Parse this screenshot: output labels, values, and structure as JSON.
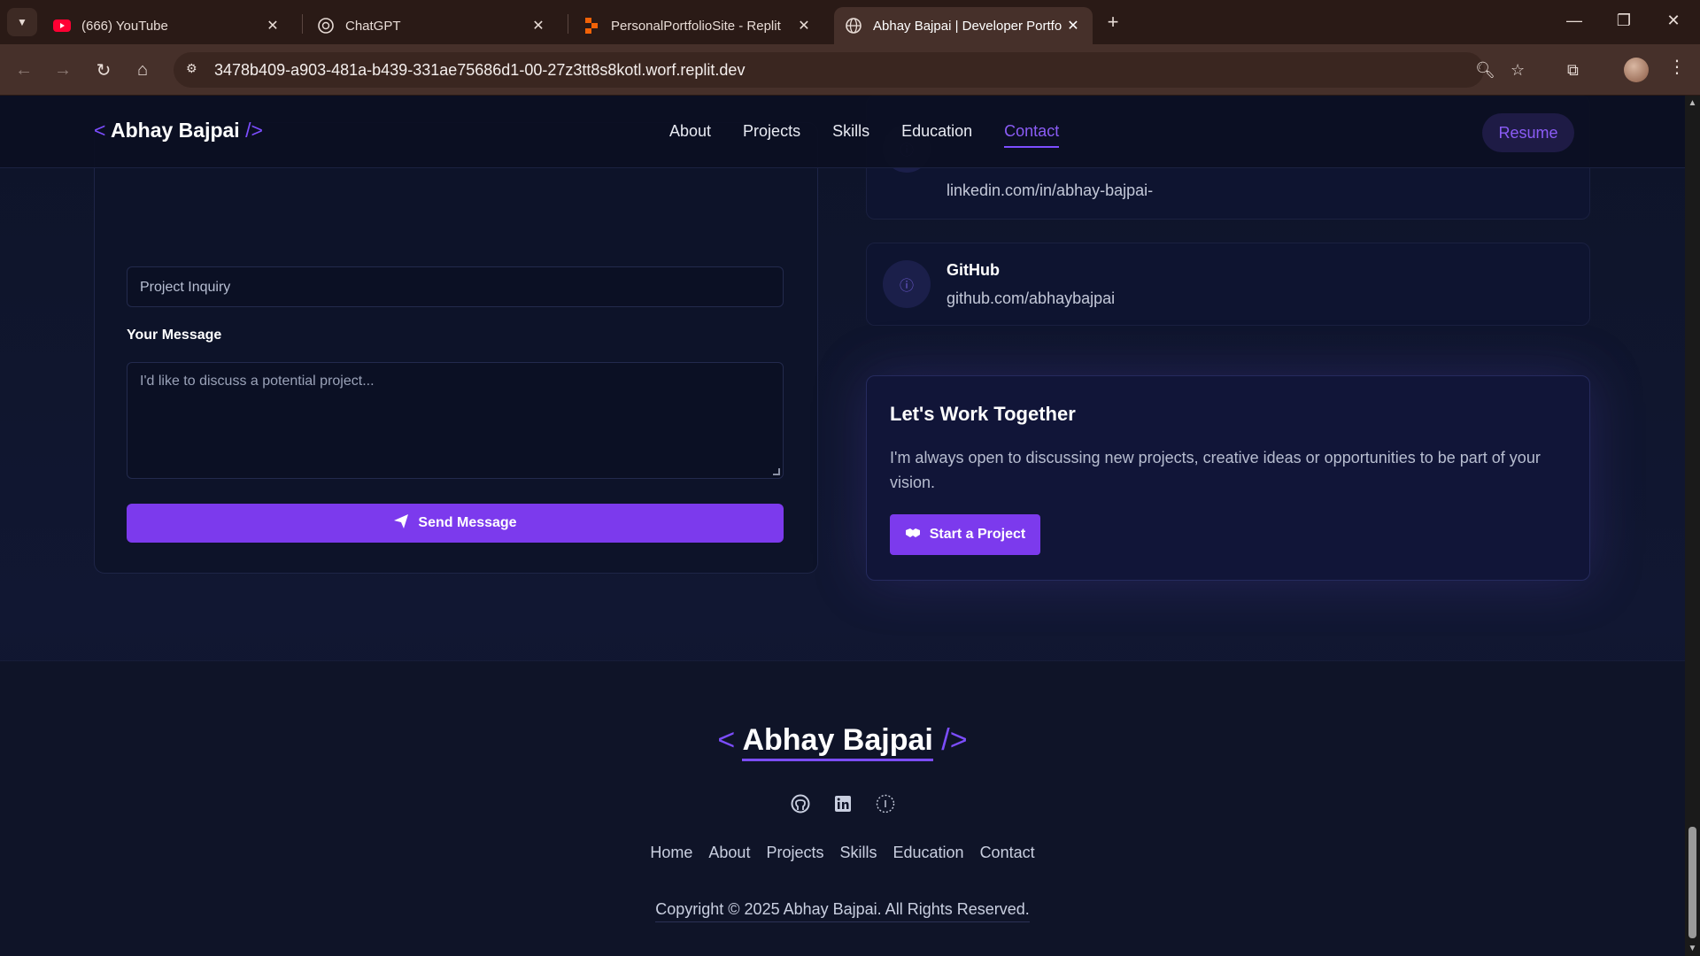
{
  "browser": {
    "tabs": [
      {
        "title": "(666) YouTube",
        "icon": "youtube-icon",
        "active": false
      },
      {
        "title": "ChatGPT",
        "icon": "chatgpt-icon",
        "active": false
      },
      {
        "title": "PersonalPortfolioSite - Replit",
        "icon": "replit-icon",
        "active": false
      },
      {
        "title": "Abhay Bajpai | Developer Portfo",
        "icon": "globe-icon",
        "active": true
      }
    ],
    "url": "3478b409-a903-481a-b439-331ae75686d1-00-27z3tt8s8kotl.worf.replit.dev"
  },
  "header": {
    "logo_open": "<",
    "logo_name": "Abhay Bajpai",
    "logo_close": "/>",
    "nav": [
      "About",
      "Projects",
      "Skills",
      "Education",
      "Contact"
    ],
    "active_nav": "Contact",
    "resume_label": "Resume"
  },
  "form": {
    "subject_value": "Project Inquiry",
    "message_label": "Your Message",
    "message_placeholder": "I'd like to discuss a potential project...",
    "send_label": "Send Message"
  },
  "contacts": [
    {
      "title": "",
      "value": "linkedin.com/in/abhay-bajpai-"
    },
    {
      "title": "GitHub",
      "value": "github.com/abhaybajpai"
    }
  ],
  "work": {
    "heading": "Let's Work Together",
    "text": "I'm always open to discussing new projects, creative ideas or opportunities to be part of your vision.",
    "button_label": "Start a Project"
  },
  "footer": {
    "logo_open": "<",
    "logo_name": "Abhay Bajpai",
    "logo_close": "/>",
    "social_icons": [
      "github-icon",
      "linkedin-icon",
      "info-icon"
    ],
    "links": [
      "Home",
      "About",
      "Projects",
      "Skills",
      "Education",
      "Contact"
    ],
    "copyright": "Copyright © 2025 Abhay Bajpai. All Rights Reserved."
  },
  "colors": {
    "accent": "#7c3aed",
    "accent_text": "#8b5cf6",
    "background": "#0e1429",
    "chrome": "#46302a"
  }
}
